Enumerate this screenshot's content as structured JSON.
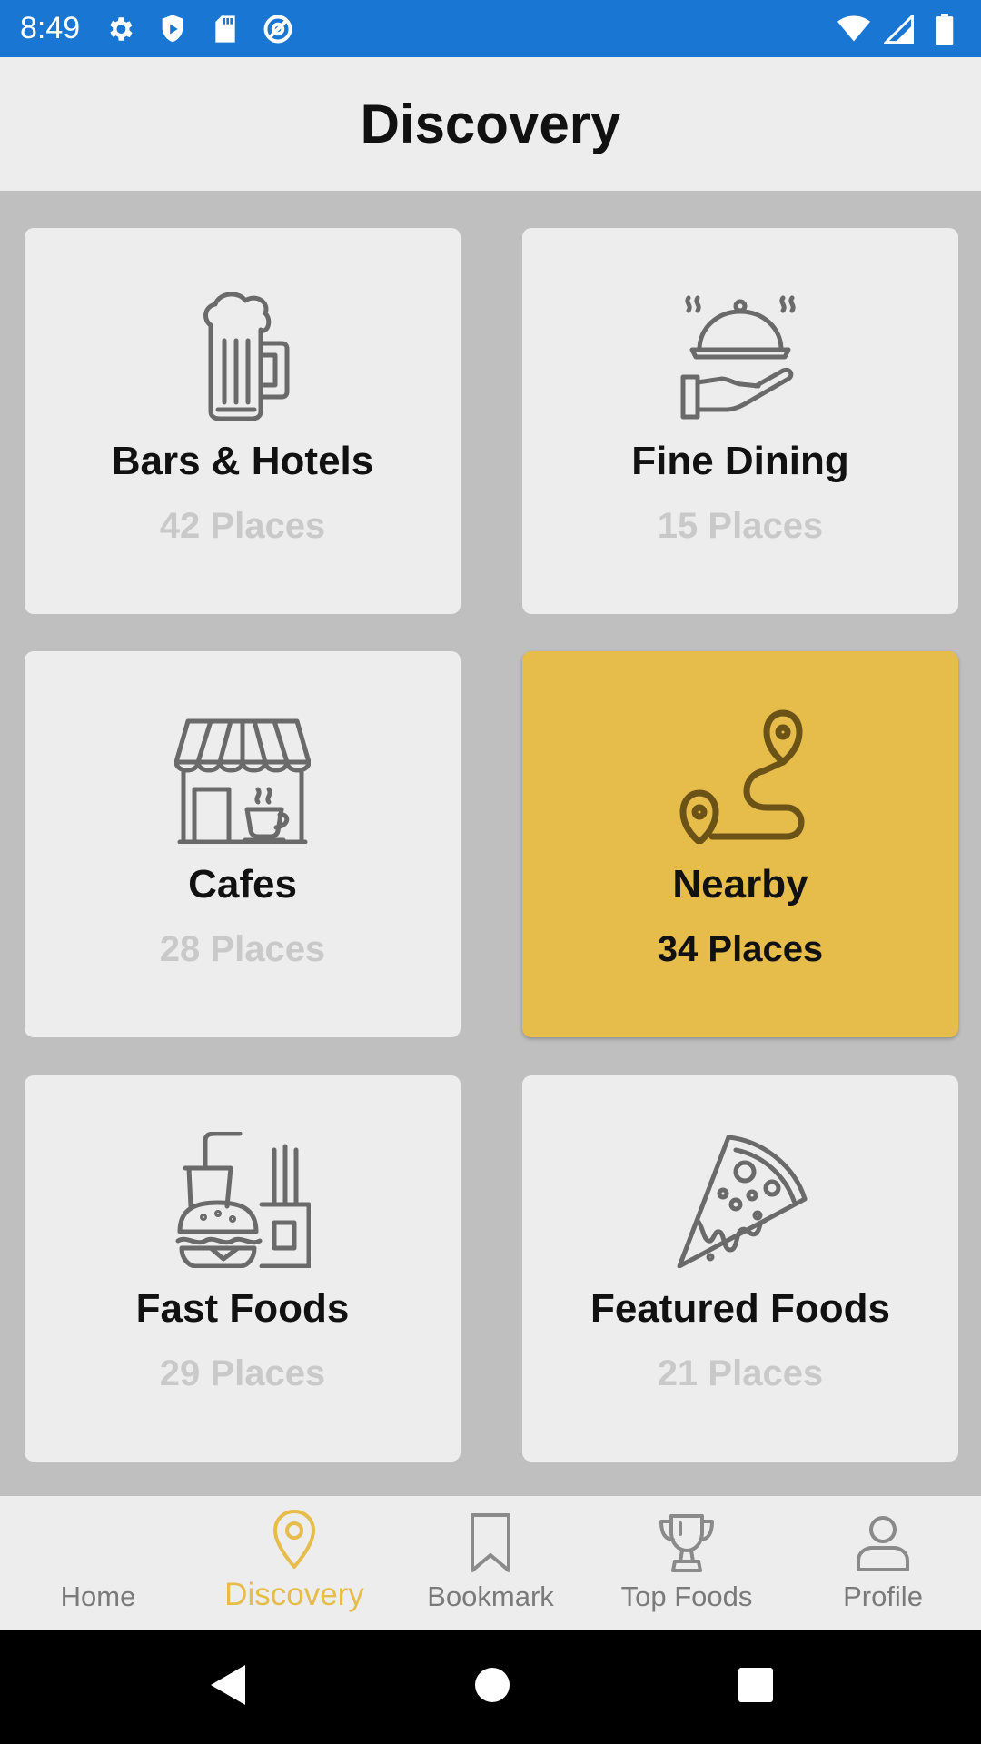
{
  "status_bar": {
    "time": "8:49"
  },
  "header": {
    "title": "Discovery"
  },
  "cards": [
    {
      "title": "Bars & Hotels",
      "count": "42 Places",
      "icon": "beer-mug-icon"
    },
    {
      "title": "Fine Dining",
      "count": "15 Places",
      "icon": "cloche-serving-icon"
    },
    {
      "title": "Cafes",
      "count": "28 Places",
      "icon": "cafe-store-icon"
    },
    {
      "title": "Nearby",
      "count": "34 Places",
      "icon": "route-pin-icon"
    },
    {
      "title": "Fast Foods",
      "count": "29 Places",
      "icon": "burger-drink-fries-icon"
    },
    {
      "title": "Featured Foods",
      "count": "21 Places",
      "icon": "pizza-slice-icon"
    }
  ],
  "bottom_nav": [
    {
      "label": "Home",
      "icon": ""
    },
    {
      "label": "Discovery",
      "icon": "location-pin-icon"
    },
    {
      "label": "Bookmark",
      "icon": "bookmark-icon"
    },
    {
      "label": "Top Foods",
      "icon": "trophy-icon"
    },
    {
      "label": "Profile",
      "icon": "person-icon"
    }
  ],
  "colors": {
    "status_bar": "#1976d2",
    "accent": "#e6bc4a",
    "card": "#ededed",
    "background": "#bfbfbf"
  }
}
